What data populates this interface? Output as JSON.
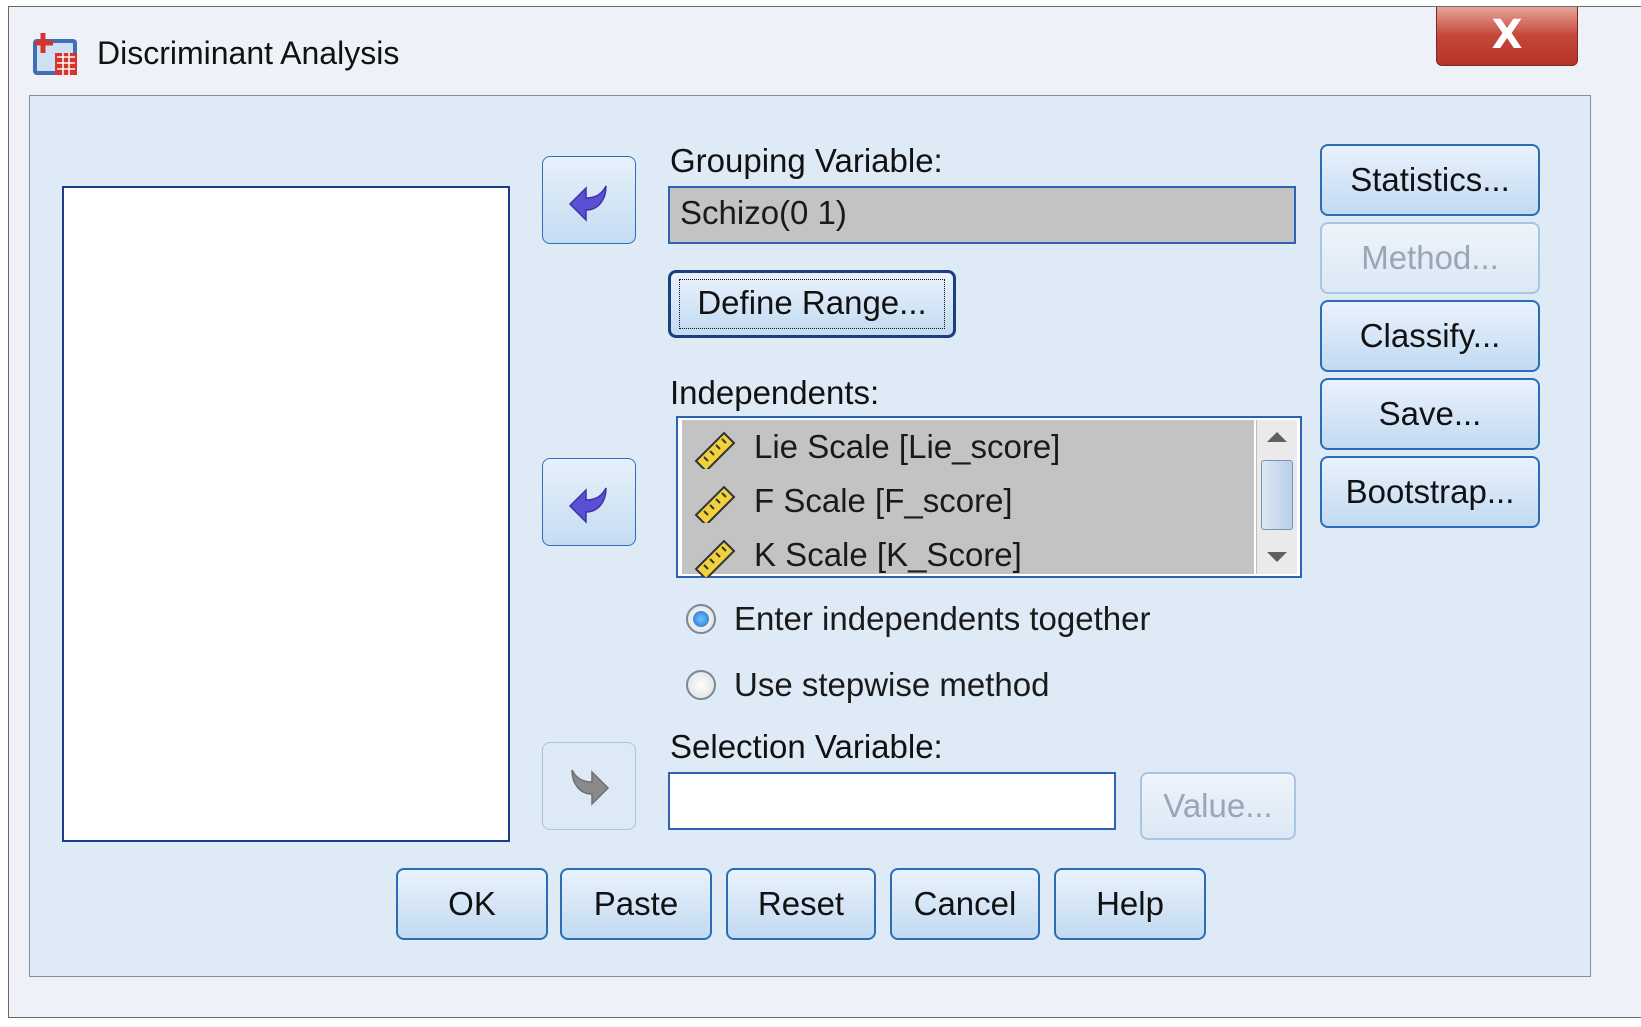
{
  "window": {
    "title": "Discriminant Analysis",
    "close_label": "X"
  },
  "grouping": {
    "label": "Grouping Variable:",
    "value": "Schizo(0 1)",
    "define_range_label": "Define Range..."
  },
  "independents": {
    "label": "Independents:",
    "items": [
      {
        "label": "Lie Scale [Lie_score]",
        "icon": "scale-ruler-icon"
      },
      {
        "label": "F Scale [F_score]",
        "icon": "scale-ruler-icon"
      },
      {
        "label": "K Scale [K_Score]",
        "icon": "scale-ruler-icon"
      }
    ]
  },
  "method_options": {
    "enter_label": "Enter independents together",
    "stepwise_label": "Use stepwise method",
    "selected": "enter"
  },
  "selection": {
    "label": "Selection Variable:",
    "value": "",
    "value_button_label": "Value..."
  },
  "side_buttons": {
    "statistics": "Statistics...",
    "method": "Method...",
    "classify": "Classify...",
    "save": "Save...",
    "bootstrap": "Bootstrap..."
  },
  "bottom_buttons": {
    "ok": "OK",
    "paste": "Paste",
    "reset": "Reset",
    "cancel": "Cancel",
    "help": "Help"
  },
  "colors": {
    "accent": "#2d63b0",
    "arrow": "#5b4fd6",
    "field_bg": "#c3c3c3",
    "client_bg": "#dfeaf7"
  }
}
